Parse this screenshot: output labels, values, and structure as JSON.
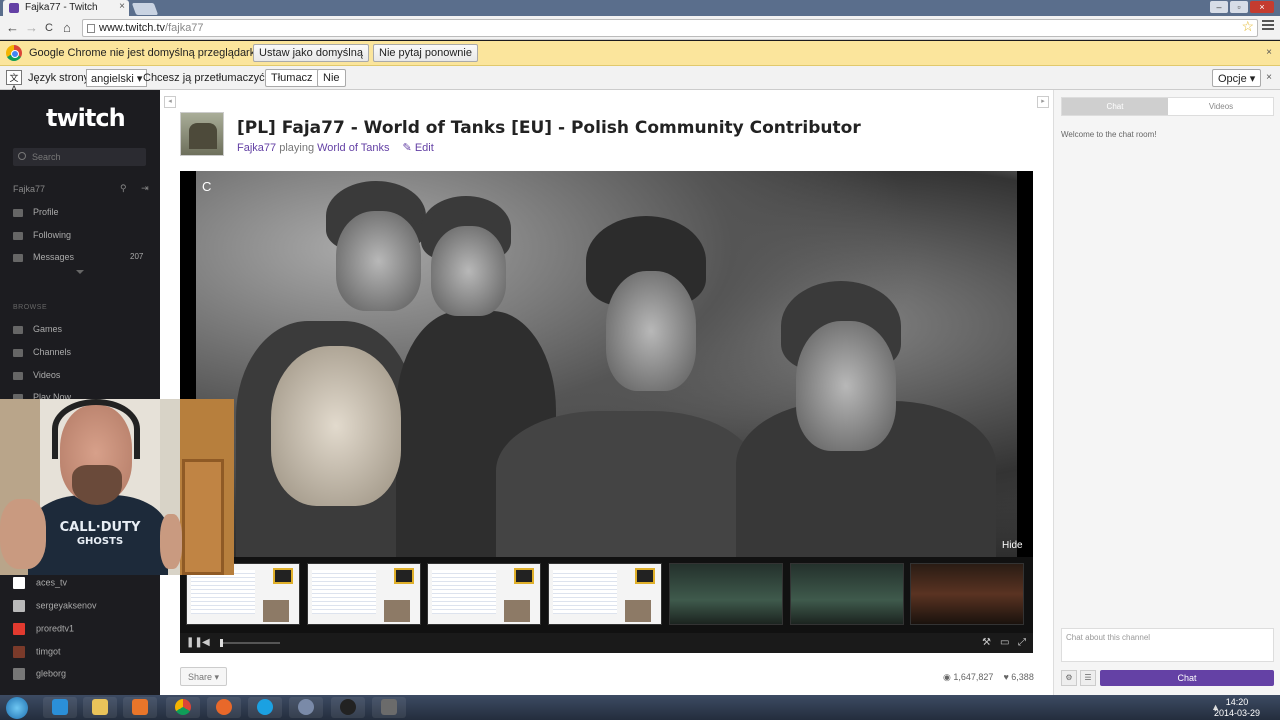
{
  "browser": {
    "tab_title": "Fajka77 - Twitch",
    "tab_close": "×",
    "url_host": "www.twitch.tv",
    "url_path": "/fajka77",
    "win_min": "–",
    "win_max": "▫",
    "win_close": "×",
    "back": "←",
    "forward": "→",
    "reload": "C",
    "home": "⌂",
    "star": "☆"
  },
  "infobar": {
    "message": "Google Chrome nie jest domyślną przeglądarką.",
    "set_default": "Ustaw jako domyślną",
    "dont_ask": "Nie pytaj ponownie",
    "close": "×"
  },
  "translate": {
    "icon": "文A",
    "label_lang": "Język strony:",
    "lang_value": "angielski ▾",
    "label_question": "Chcesz ją przetłumaczyć?",
    "translate_btn": "Tłumacz",
    "no_btn": "Nie",
    "options_btn": "Opcje ▾",
    "close": "×"
  },
  "sidebar": {
    "logo": "twitch",
    "search_placeholder": "Search",
    "username": "Fajka77",
    "user_icons": "⚲ ⇥",
    "items": [
      {
        "label": "Profile"
      },
      {
        "label": "Following"
      },
      {
        "label": "Messages",
        "badge": "207"
      }
    ],
    "browse_header": "BROWSE",
    "browse": [
      {
        "label": "Games"
      },
      {
        "label": "Channels"
      },
      {
        "label": "Videos"
      },
      {
        "label": "Play Now"
      }
    ],
    "following": [
      {
        "name": "aces_tv",
        "color": "#ffffff"
      },
      {
        "name": "sergeyaksenov",
        "color": "#b9b9b9"
      },
      {
        "name": "proredtv1",
        "color": "#e23a2f"
      },
      {
        "name": "timgot",
        "color": "#7a3a2a"
      },
      {
        "name": "gleborg",
        "color": "#777777"
      }
    ]
  },
  "webcam": {
    "shirt_line1": "CALL·DUTY",
    "shirt_line2": "GHOSTS"
  },
  "channel": {
    "title": "[PL] Faja77 - World of Tanks [EU] - Polish Community Contributor",
    "streamer": "Fajka77",
    "playing_word": " playing ",
    "game": "World of Tanks",
    "edit": "✎ Edit",
    "collapse_left": "◂",
    "collapse_right": "▸"
  },
  "player": {
    "corner_mark": "C",
    "hide_label": "Hide",
    "pause": "❚❚",
    "volume": "◀",
    "settings": "⚒",
    "popout": "▭",
    "fullscreen": "⤢"
  },
  "footer": {
    "share": "Share ▾",
    "views_icon": "◉",
    "views": "1,647,827",
    "followers_icon": "♥",
    "followers": "6,388"
  },
  "chat": {
    "tab_chat": "Chat",
    "tab_videos": "Videos",
    "welcome": "Welcome to the chat room!",
    "input_placeholder": "Chat about this channel",
    "settings_icon": "⚙",
    "list_icon": "☰",
    "send": "Chat"
  },
  "taskbar": {
    "clock_time": "14:20",
    "clock_date": "2014-03-29",
    "tray_arrow": "▲"
  }
}
